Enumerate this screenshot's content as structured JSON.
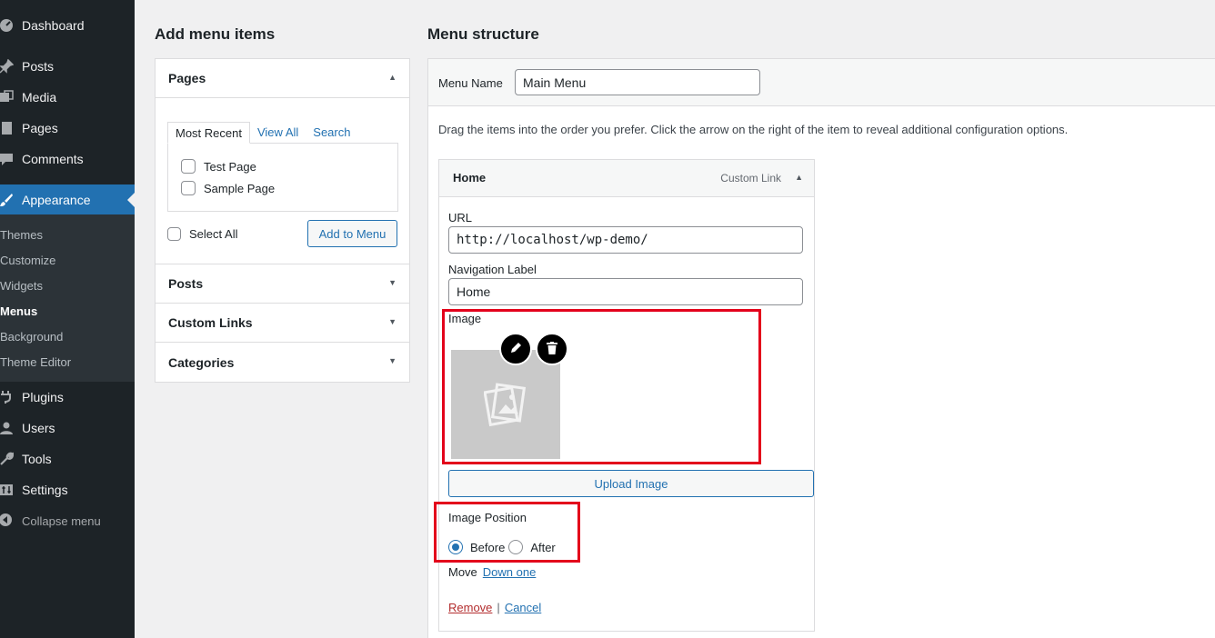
{
  "sidebar": {
    "items": [
      {
        "label": "Dashboard",
        "icon": "dashboard-icon"
      },
      {
        "label": "Posts",
        "icon": "pin-icon"
      },
      {
        "label": "Media",
        "icon": "media-icon"
      },
      {
        "label": "Pages",
        "icon": "pages-icon"
      },
      {
        "label": "Comments",
        "icon": "comment-icon"
      },
      {
        "label": "Appearance",
        "icon": "brush-icon",
        "active": true
      },
      {
        "label": "Plugins",
        "icon": "plugin-icon"
      },
      {
        "label": "Users",
        "icon": "user-icon"
      },
      {
        "label": "Tools",
        "icon": "wrench-icon"
      },
      {
        "label": "Settings",
        "icon": "settings-icon"
      }
    ],
    "submenu": [
      "Themes",
      "Customize",
      "Widgets",
      "Menus",
      "Background",
      "Theme Editor"
    ],
    "current_submenu": "Menus",
    "collapse_label": "Collapse menu"
  },
  "add_menu_items": {
    "title": "Add menu items",
    "pages": {
      "title": "Pages",
      "tabs": [
        "Most Recent",
        "View All",
        "Search"
      ],
      "items": [
        "Test Page",
        "Sample Page"
      ],
      "select_all": "Select All",
      "add_button": "Add to Menu"
    },
    "sections": [
      "Posts",
      "Custom Links",
      "Categories"
    ]
  },
  "menu_structure": {
    "title": "Menu structure",
    "menu_name_label": "Menu Name",
    "menu_name_value": "Main Menu",
    "instructions": "Drag the items into the order you prefer. Click the arrow on the right of the item to reveal additional configuration options.",
    "item": {
      "title": "Home",
      "type": "Custom Link",
      "url_label": "URL",
      "url_value": "http://localhost/wp-demo/",
      "nav_label": "Navigation Label",
      "nav_value": "Home",
      "image_label": "Image",
      "upload_button": "Upload Image",
      "position_label": "Image Position",
      "position_options": [
        "Before",
        "After"
      ],
      "position_selected": "Before",
      "move_label": "Move",
      "move_link": "Down one",
      "remove": "Remove",
      "separator": "|",
      "cancel": "Cancel"
    }
  },
  "colors": {
    "sidebar_bg": "#1d2327",
    "active_blue": "#2271b1",
    "highlight_red": "#e3001b"
  }
}
